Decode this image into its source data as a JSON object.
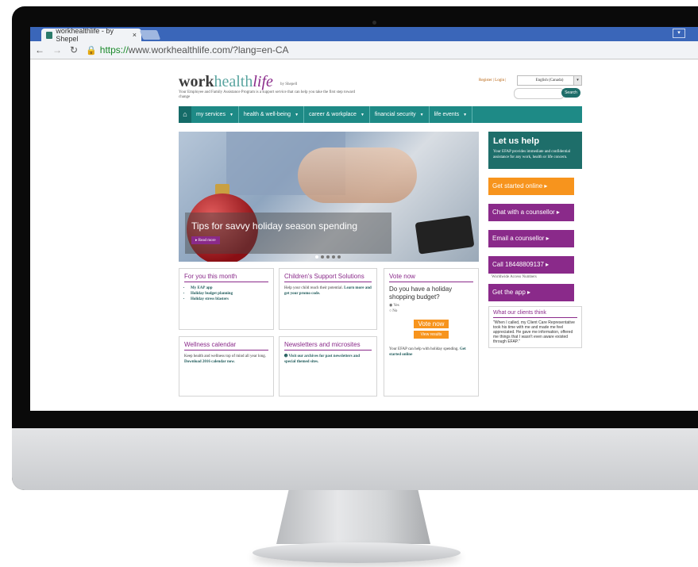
{
  "browser": {
    "tab_title": "workhealthlife - by Shepel",
    "tab_close": "×",
    "url_https": "https://",
    "url_rest": "www.workhealthlife.com/?lang=en-CA"
  },
  "site": {
    "logo_work": "work",
    "logo_health": "health",
    "logo_life": "life",
    "byline": "by Shepell",
    "tagline": "Your Employee and Family Assistance Program is a support service that can help you take the first step toward change",
    "toplinks": "Register | Login |",
    "language": "English (Canada)",
    "search_button": "Search"
  },
  "nav": {
    "items": [
      {
        "label": "my services"
      },
      {
        "label": "health & well-being"
      },
      {
        "label": "career & workplace"
      },
      {
        "label": "financial security"
      },
      {
        "label": "life events"
      }
    ]
  },
  "hero": {
    "title": "Tips for savvy holiday season spending",
    "read_more": "▸ Read more"
  },
  "cards": {
    "month": {
      "title": "For you this month",
      "items": [
        "My EAP app",
        "Holiday budget planning",
        "Holiday stress blasters"
      ]
    },
    "children": {
      "title": "Children's Support Solutions",
      "text1": "Help your child reach their potential.",
      "text2": "Learn more and get your promo code."
    },
    "vote": {
      "title": "Vote now",
      "question": "Do you have a holiday shopping budget?",
      "yes": "Yes",
      "no": "No",
      "vote_button": "Vote now",
      "results_button": "View results",
      "footer": "Your EFAP can help with holiday spending.",
      "footer_link": "Get started online"
    },
    "wellness": {
      "title": "Wellness calendar",
      "text": "Keep health and wellness top of mind all year long.",
      "link": "Download 2016 calendar now."
    },
    "newsletters": {
      "title": "Newsletters and microsites",
      "text": "Visit our archives for past newsletters and special themed sites."
    }
  },
  "sidebar": {
    "title": "Let us help",
    "desc": "Your EFAP provides immediate and confidential assistance for any work, health or life concern.",
    "buttons": [
      {
        "label": "Get started online ▸"
      },
      {
        "label": "Chat with a counsellor ▸"
      },
      {
        "label": "Email a counsellor ▸"
      },
      {
        "label": "Call 18448809137 ▸"
      },
      {
        "label": "Get the app ▸"
      }
    ],
    "access_note": "Worldwide Access Numbers",
    "clients_title": "What our clients think",
    "quote": "\"When I called, my Client Care Representative took his time with me and made me feel appreciated. He gave me information, offered me things that I wasn't even aware existed through EFAP.\""
  },
  "colors": {
    "teal": "#1e8a86",
    "dark_teal": "#1e6e6a",
    "purple": "#8a2a8a",
    "orange": "#f7941d",
    "browser_blue": "#3a66b9"
  }
}
